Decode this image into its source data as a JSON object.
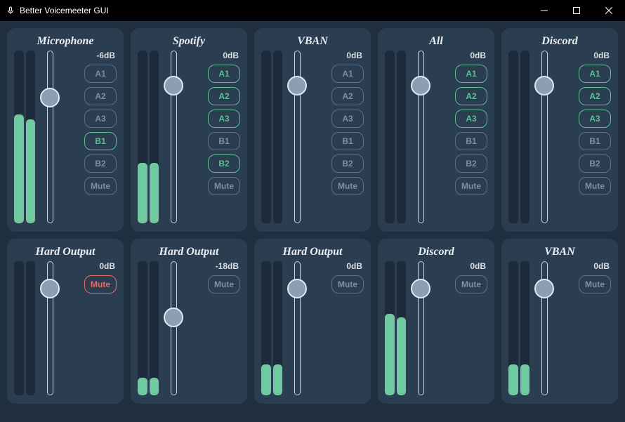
{
  "window": {
    "title": "Better Voicemeeter GUI"
  },
  "buttons": {
    "a1": "A1",
    "a2": "A2",
    "a3": "A3",
    "b1": "B1",
    "b2": "B2",
    "mute": "Mute"
  },
  "inputs": [
    {
      "id": "mic",
      "title": "Microphone",
      "db": "-6dB",
      "slider_pct": 27,
      "meters": [
        63,
        60
      ],
      "routes": {
        "a1": false,
        "a2": false,
        "a3": false,
        "b1": true,
        "b2": false
      },
      "mute": false
    },
    {
      "id": "spotify",
      "title": "Spotify",
      "db": "0dB",
      "slider_pct": 20,
      "meters": [
        35,
        35
      ],
      "routes": {
        "a1": true,
        "a2": true,
        "a3": true,
        "b1": false,
        "b2": true
      },
      "mute": false
    },
    {
      "id": "vban-in",
      "title": "VBAN",
      "db": "0dB",
      "slider_pct": 20,
      "meters": [
        0,
        0
      ],
      "routes": {
        "a1": false,
        "a2": false,
        "a3": false,
        "b1": false,
        "b2": false
      },
      "mute": false
    },
    {
      "id": "all",
      "title": "All",
      "db": "0dB",
      "slider_pct": 20,
      "meters": [
        0,
        0
      ],
      "routes": {
        "a1": true,
        "a2": true,
        "a3": true,
        "b1": false,
        "b2": false
      },
      "mute": false
    },
    {
      "id": "discord-in",
      "title": "Discord",
      "db": "0dB",
      "slider_pct": 20,
      "meters": [
        0,
        0
      ],
      "routes": {
        "a1": true,
        "a2": true,
        "a3": true,
        "b1": false,
        "b2": false
      },
      "mute": false
    }
  ],
  "outputs": [
    {
      "id": "hard-out-1",
      "title": "Hard Output",
      "db": "0dB",
      "slider_pct": 20,
      "meters": [
        0,
        0
      ],
      "mute": true
    },
    {
      "id": "hard-out-2",
      "title": "Hard Output",
      "db": "-18dB",
      "slider_pct": 42,
      "meters": [
        13,
        13
      ],
      "mute": false
    },
    {
      "id": "hard-out-3",
      "title": "Hard Output",
      "db": "0dB",
      "slider_pct": 20,
      "meters": [
        23,
        23
      ],
      "mute": false
    },
    {
      "id": "discord-out",
      "title": "Discord",
      "db": "0dB",
      "slider_pct": 20,
      "meters": [
        61,
        58
      ],
      "mute": false
    },
    {
      "id": "vban-out",
      "title": "VBAN",
      "db": "0dB",
      "slider_pct": 20,
      "meters": [
        23,
        23
      ],
      "mute": false
    }
  ]
}
